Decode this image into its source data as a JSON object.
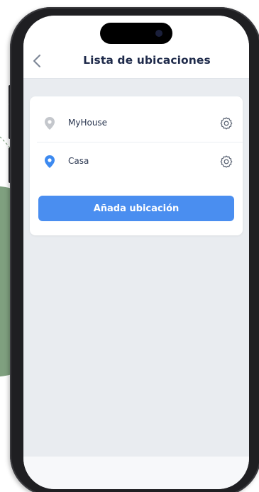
{
  "header": {
    "title": "Lista de ubicaciones",
    "back_icon": "chevron-left-icon"
  },
  "locations": [
    {
      "name": "MyHouse",
      "pin_color": "#c4c7cc",
      "icon": "location-pin-icon",
      "settings_icon": "gear-icon"
    },
    {
      "name": "Casa",
      "pin_color": "#3d8af0",
      "icon": "location-pin-icon",
      "settings_icon": "gear-icon"
    }
  ],
  "add_button": {
    "label": "Añada ubicación",
    "color": "#4a8ef0"
  },
  "colors": {
    "title": "#1e2a4a",
    "screen_background": "#e9ecf0",
    "decorative_blob": "#7fa07f"
  }
}
